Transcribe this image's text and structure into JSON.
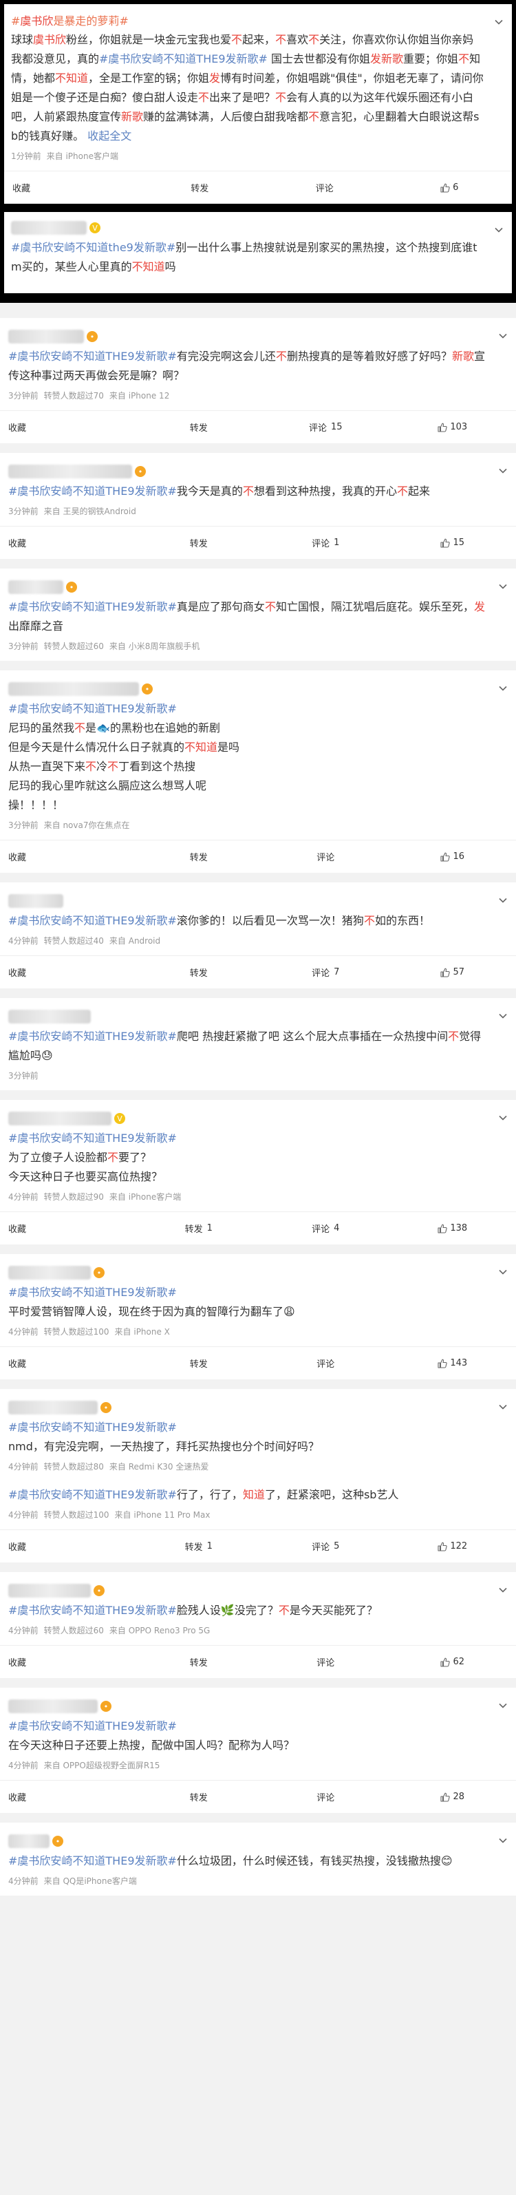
{
  "colors": {
    "topic": "#eb7350",
    "highlight": "#e8453c",
    "link": "#5d83c2",
    "meta": "#999999",
    "frame": "#000000"
  },
  "action_labels": {
    "collect": "收藏",
    "repost": "转发",
    "comment": "评论"
  },
  "posts": [
    {
      "id": "p1",
      "topic_prefix": "#",
      "topic_main": "虞书欣",
      "topic_rest": "是暴走的萝莉#",
      "body": [
        {
          "t": "球球"
        },
        {
          "t": "虞书欣",
          "c": "hl"
        },
        {
          "t": "粉丝，你姐就是一块金元宝我也爱"
        },
        {
          "t": "不",
          "c": "hl"
        },
        {
          "t": "起来，"
        },
        {
          "t": "不",
          "c": "hl"
        },
        {
          "t": "喜欢"
        },
        {
          "t": "不",
          "c": "hl"
        },
        {
          "t": "关注，你喜欢你认你姐当你亲妈我都没意见，真的"
        },
        {
          "t": "#虞书欣安崎不知道THE9发新歌#",
          "c": "topic"
        },
        {
          "t": " 国士去世都没有你姐"
        },
        {
          "t": "发新歌",
          "c": "hl"
        },
        {
          "t": "重要；你姐"
        },
        {
          "t": "不",
          "c": "hl"
        },
        {
          "t": "知情，她都"
        },
        {
          "t": "不知道",
          "c": "hl"
        },
        {
          "t": "，全是工作室的锅；你姐"
        },
        {
          "t": "发",
          "c": "hl"
        },
        {
          "t": "博有时间差，你姐唱跳\"俱佳\"，你姐老无辜了，请问你姐是一个傻子还是白痴？傻白甜人设走"
        },
        {
          "t": "不",
          "c": "hl"
        },
        {
          "t": "出来了是吧？"
        },
        {
          "t": "不",
          "c": "hl"
        },
        {
          "t": "会有人真的以为这年代娱乐圈还有小白吧，人前紧跟热度宣传"
        },
        {
          "t": "新歌",
          "c": "hl"
        },
        {
          "t": "赚的盆满钵满，人后傻白甜我啥都"
        },
        {
          "t": "不",
          "c": "hl"
        },
        {
          "t": "意言犯，心里翻着大白眼说这帮sb的钱真好赚。"
        }
      ],
      "expand_label": "收起全文",
      "meta_time": "1分钟前",
      "meta_source": "来自 iPhone客户端",
      "repost_count": "",
      "comment_count": "",
      "like_count": "6",
      "name_width_fraction": 0.0,
      "badge": "none",
      "framed": true,
      "show_actions": true
    },
    {
      "id": "p2",
      "body": [
        {
          "t": "#虞书欣安崎不知道the9发新歌#",
          "c": "topic"
        },
        {
          "t": "别一出什么事上热搜就说是别家买的黑热搜，这个热搜到底谁tm买的，某些人心里真的"
        },
        {
          "t": "不知道",
          "c": "hl"
        },
        {
          "t": "吗"
        }
      ],
      "meta_time": "",
      "meta_source": "",
      "like_count": "",
      "badge": "gold",
      "framed": true,
      "show_actions": false
    },
    {
      "id": "p3",
      "body": [
        {
          "t": "#虞书欣安崎不知道THE9发新歌#",
          "c": "topic"
        },
        {
          "t": "有完没完啊这会儿还"
        },
        {
          "t": "不",
          "c": "hl"
        },
        {
          "t": "删热搜真的是等着败好感了好吗？"
        },
        {
          "t": "新歌",
          "c": "hl"
        },
        {
          "t": "宣传这种事过两天再做会死是嘛？啊？"
        }
      ],
      "meta_time": "3分钟前",
      "meta_extra": "转赞人数超过70",
      "meta_source": "来自 iPhone 12",
      "repost_count": "",
      "comment_count": "15",
      "like_count": "103",
      "badge": "orange",
      "framed": false,
      "show_actions": true
    },
    {
      "id": "p4",
      "body": [
        {
          "t": "#虞书欣安崎不知道THE9发新歌#",
          "c": "topic"
        },
        {
          "t": "我今天是真的"
        },
        {
          "t": "不",
          "c": "hl"
        },
        {
          "t": "想看到这种热搜，我真的开心"
        },
        {
          "t": "不",
          "c": "hl"
        },
        {
          "t": "起来"
        }
      ],
      "meta_time": "3分钟前",
      "meta_source": "来自 王昊的钢铁Android",
      "repost_count": "",
      "comment_count": "1",
      "like_count": "15",
      "badge": "orange",
      "framed": false,
      "show_actions": true
    },
    {
      "id": "p5",
      "body": [
        {
          "t": "#虞书欣安崎不知道THE9发新歌#",
          "c": "topic"
        },
        {
          "t": "真是应了那句商女"
        },
        {
          "t": "不",
          "c": "hl"
        },
        {
          "t": "知亡国恨，隔江犹唱后庭花。娱乐至死，"
        },
        {
          "t": "发",
          "c": "hl"
        },
        {
          "t": "出靡靡之音"
        }
      ],
      "meta_time": "3分钟前",
      "meta_extra": "转赞人数超过60",
      "meta_source": "来自 小米8周年旗舰手机",
      "badge": "orange",
      "framed": false,
      "show_actions": false
    },
    {
      "id": "p6",
      "body": [
        {
          "t": "#虞书欣安崎不知道THE9发新歌#",
          "c": "topic"
        },
        {
          "br": true
        },
        {
          "t": "尼玛的虽然我"
        },
        {
          "t": "不",
          "c": "hl"
        },
        {
          "t": "是🐟的黑粉也在追她的新剧"
        },
        {
          "br": true
        },
        {
          "t": "但是今天是什么情况什么日子就真的"
        },
        {
          "t": "不知道",
          "c": "hl"
        },
        {
          "t": "是吗"
        },
        {
          "br": true
        },
        {
          "t": "从热一直哭下来"
        },
        {
          "t": "不",
          "c": "hl"
        },
        {
          "t": "冷"
        },
        {
          "t": "不",
          "c": "hl"
        },
        {
          "t": "丁看到这个热搜"
        },
        {
          "br": true
        },
        {
          "t": "尼玛的我心里咋就这么膈应这么想骂人呢"
        },
        {
          "br": true
        },
        {
          "t": "操！！！！"
        }
      ],
      "meta_time": "3分钟前",
      "meta_source": "来自 nova7你在焦点在",
      "repost_count": "",
      "comment_count": "",
      "like_count": "16",
      "badge": "orange",
      "framed": false,
      "show_actions": true
    },
    {
      "id": "p7",
      "body": [
        {
          "t": "#虞书欣安崎不知道THE9发新歌#",
          "c": "topic"
        },
        {
          "t": "滚你爹的！以后看见一次骂一次！猪狗"
        },
        {
          "t": "不",
          "c": "hl"
        },
        {
          "t": "如的东西！"
        }
      ],
      "meta_time": "4分钟前",
      "meta_extra": "转赞人数超过40",
      "meta_source": "来自 Android",
      "repost_count": "",
      "comment_count": "7",
      "like_count": "57",
      "badge": "none",
      "framed": false,
      "show_actions": true
    },
    {
      "id": "p8",
      "body": [
        {
          "t": "#虞书欣安崎不知道THE9发新歌#",
          "c": "topic"
        },
        {
          "t": "爬吧 热搜赶紧撤了吧 这么个屁大点事插在一众热搜中间"
        },
        {
          "t": "不",
          "c": "hl"
        },
        {
          "t": "觉得尴尬吗😓"
        }
      ],
      "meta_time": "3分钟前",
      "meta_source": "",
      "badge": "none",
      "framed": false,
      "show_actions": false
    },
    {
      "id": "p9",
      "body": [
        {
          "t": "#虞书欣安崎不知道THE9发新歌#",
          "c": "topic"
        },
        {
          "br": true
        },
        {
          "t": "为了立傻子人设脸都"
        },
        {
          "t": "不",
          "c": "hl"
        },
        {
          "t": "要了？"
        },
        {
          "br": true
        },
        {
          "t": "今天这种日子也要买高位热搜？"
        }
      ],
      "meta_time": "4分钟前",
      "meta_extra": "转赞人数超过90",
      "meta_source": "来自 iPhone客户端",
      "repost_count": "1",
      "comment_count": "4",
      "like_count": "138",
      "badge": "gold",
      "framed": false,
      "show_actions": true
    },
    {
      "id": "p10",
      "body": [
        {
          "t": "#虞书欣安崎不知道THE9发新歌#",
          "c": "topic"
        },
        {
          "br": true
        },
        {
          "t": "平时爱营销智障人设，现在终于因为真的智障行为翻车了😩"
        }
      ],
      "meta_time": "4分钟前",
      "meta_extra": "转赞人数超过100",
      "meta_source": "来自 iPhone X",
      "repost_count": "",
      "comment_count": "",
      "like_count": "143",
      "badge": "orange",
      "framed": false,
      "show_actions": true
    },
    {
      "id": "p11",
      "body": [
        {
          "t": "#虞书欣安崎不知道THE9发新歌#",
          "c": "topic"
        },
        {
          "br": true
        },
        {
          "t": "nmd，有完没完啊，一天热搜了，拜托买热搜也分个时间好吗？"
        }
      ],
      "meta_time": "4分钟前",
      "meta_extra": "转赞人数超过80",
      "meta_source": "来自 Redmi K30 全速热爱",
      "badge": "orange",
      "framed": false,
      "show_actions": false,
      "continued": true
    },
    {
      "id": "p11b",
      "body": [
        {
          "t": "#虞书欣安崎不知道THE9发新歌#",
          "c": "topic"
        },
        {
          "t": "行了，行了，"
        },
        {
          "t": "知道",
          "c": "hl"
        },
        {
          "t": "了，赶紧滚吧，这种sb艺人"
        }
      ],
      "meta_time": "4分钟前",
      "meta_extra": "转赞人数超过100",
      "meta_source": "来自 iPhone 11 Pro Max",
      "repost_count": "1",
      "comment_count": "5",
      "like_count": "122",
      "badge": "none",
      "framed": false,
      "show_actions": true,
      "no_header": true
    },
    {
      "id": "p12",
      "body": [
        {
          "t": "#虞书欣安崎不知道THE9发新歌#",
          "c": "topic"
        },
        {
          "t": "脸残人设🌿没完了？"
        },
        {
          "t": "不",
          "c": "hl"
        },
        {
          "t": "是今天买能死了？"
        }
      ],
      "meta_time": "4分钟前",
      "meta_extra": "转赞人数超过60",
      "meta_source": "来自 OPPO Reno3 Pro 5G",
      "repost_count": "",
      "comment_count": "",
      "like_count": "62",
      "badge": "orange",
      "framed": false,
      "show_actions": true
    },
    {
      "id": "p13",
      "body": [
        {
          "t": "#虞书欣安崎不知道THE9发新歌#",
          "c": "topic"
        },
        {
          "br": true
        },
        {
          "t": "在今天这种日子还要上热搜，配做中国人吗？配称为人吗？"
        }
      ],
      "meta_time": "4分钟前",
      "meta_source": "来自 OPPO超级视野全面屏R15",
      "repost_count": "",
      "comment_count": "",
      "like_count": "28",
      "badge": "orange",
      "framed": false,
      "show_actions": true
    },
    {
      "id": "p14",
      "body": [
        {
          "t": "#虞书欣安崎不知道THE9发新歌#",
          "c": "topic"
        },
        {
          "t": "什么垃圾团，什么时候还钱，有钱买热搜，没钱撤热搜😊"
        }
      ],
      "meta_time": "4分钟前",
      "meta_source": "来自 QQ是iPhone客户端",
      "badge": "orange",
      "framed": false,
      "show_actions": false
    }
  ]
}
